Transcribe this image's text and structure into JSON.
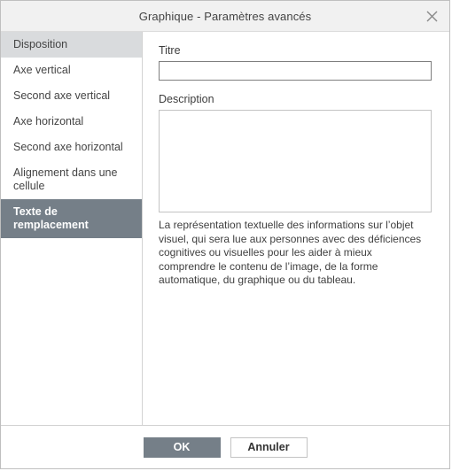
{
  "window": {
    "title": "Graphique - Paramètres avancés",
    "close_icon": "close-icon"
  },
  "sidebar": {
    "items": [
      {
        "label": "Disposition",
        "state": "hover"
      },
      {
        "label": "Axe vertical",
        "state": "normal"
      },
      {
        "label": "Second axe vertical",
        "state": "normal"
      },
      {
        "label": "Axe horizontal",
        "state": "normal"
      },
      {
        "label": "Second axe horizontal",
        "state": "normal"
      },
      {
        "label": "Alignement dans une cellule",
        "state": "normal"
      },
      {
        "label": "Texte de remplacement",
        "state": "selected"
      }
    ]
  },
  "content": {
    "title_label": "Titre",
    "title_value": "",
    "title_placeholder": "",
    "description_label": "Description",
    "description_value": "",
    "description_placeholder": "",
    "help_text": "La représentation textuelle des informations sur l’objet visuel, qui sera lue aux personnes avec des déficiences cognitives ou visuelles pour les aider à mieux comprendre le contenu de l’image, de la forme automatique, du graphique ou du tableau."
  },
  "footer": {
    "ok_label": "OK",
    "cancel_label": "Annuler"
  },
  "colors": {
    "titlebar_bg": "#f1f1f1",
    "selected_bg": "#757f88",
    "hover_bg": "#d9dbdd",
    "primary_button_bg": "#757f88",
    "text": "#444444",
    "border": "#c3c3c3"
  }
}
